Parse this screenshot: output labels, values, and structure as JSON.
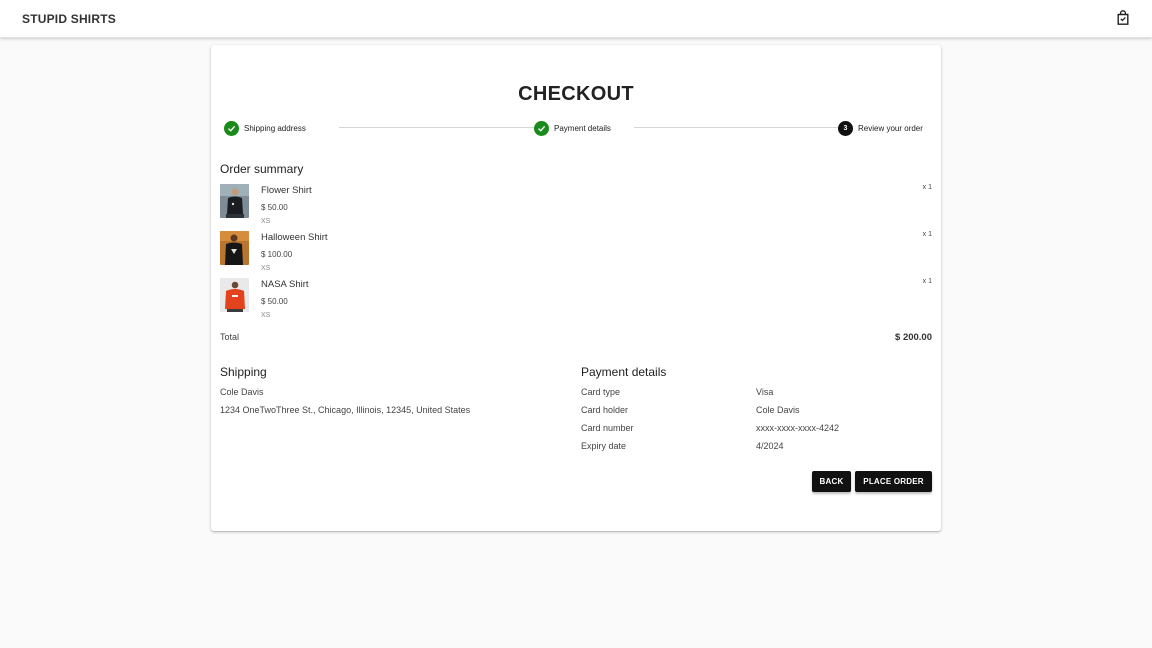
{
  "app": {
    "brand": "STUPID SHIRTS",
    "cart_icon": "shopping-bag-icon"
  },
  "checkout": {
    "title": "CHECKOUT",
    "steps": [
      {
        "label": "Shipping address",
        "state": "completed"
      },
      {
        "label": "Payment details",
        "state": "completed"
      },
      {
        "label": "Review your order",
        "number": "3",
        "state": "active"
      }
    ]
  },
  "order_summary": {
    "title": "Order summary",
    "items": [
      {
        "name": "Flower Shirt",
        "price": "$ 50.00",
        "size": "XS",
        "qty": "x 1"
      },
      {
        "name": "Halloween Shirt",
        "price": "$ 100.00",
        "size": "XS",
        "qty": "x 1"
      },
      {
        "name": "NASA Shirt",
        "price": "$ 50.00",
        "size": "XS",
        "qty": "x 1"
      }
    ],
    "total_label": "Total",
    "total_value": "$ 200.00"
  },
  "shipping": {
    "title": "Shipping",
    "name": "Cole Davis",
    "address": "1234 OneTwoThree St., Chicago, Illinois, 12345, United States"
  },
  "payment": {
    "title": "Payment details",
    "rows": [
      {
        "label": "Card type",
        "value": "Visa"
      },
      {
        "label": "Card holder",
        "value": "Cole Davis"
      },
      {
        "label": "Card number",
        "value": "xxxx-xxxx-xxxx-4242"
      },
      {
        "label": "Expiry date",
        "value": "4/2024"
      }
    ]
  },
  "actions": {
    "back": "Back",
    "place_order": "Place order"
  },
  "colors": {
    "step_done": "#1a8a1a",
    "step_active": "#111111",
    "button_bg": "#111111",
    "page_bg": "#fafafa"
  }
}
